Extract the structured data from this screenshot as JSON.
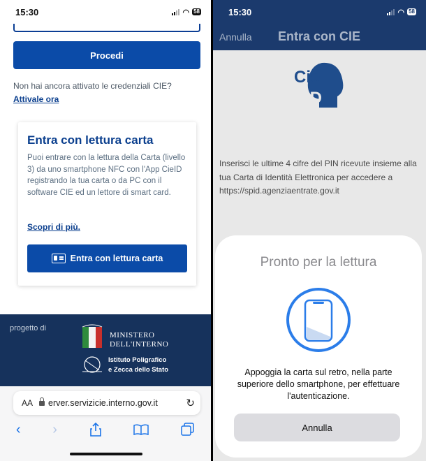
{
  "left": {
    "status": {
      "time": "15:30",
      "battery": "58"
    },
    "procedi_label": "Procedi",
    "not_activated_text": "Non hai ancora attivato le credenziali CIE?",
    "activate_link": "Attivale ora",
    "card": {
      "title": "Entra con lettura carta",
      "text": "Puoi entrare con la lettura della Carta (livello 3) da uno smartphone NFC con l'App CieID registrando la tua carta o da PC con il software CIE ed un lettore di smart card.",
      "more_link": "Scopri di più.",
      "button_label": "Entra con lettura carta"
    },
    "footer": {
      "project_of": "progetto di",
      "ministero_line1": "MINISTERO",
      "ministero_line2": "DELL'INTERNO",
      "ipzs_line1": "Istituto Poligrafico",
      "ipzs_line2": "e Zecca dello Stato"
    },
    "browser": {
      "aa_label": "AA",
      "url": "erver.servizicie.interno.gov.it"
    }
  },
  "right": {
    "status": {
      "time": "15:30",
      "battery": "58"
    },
    "nav_cancel": "Annulla",
    "nav_title": "Entra con CIE",
    "logo_text_top": "Cie",
    "logo_text_bottom": "ID",
    "instructions": "Inserisci le ultime 4 cifre del PIN ricevute insieme alla tua Carta di Identità Elettronica per accedere a https://spid.agenziaentrate.gov.it",
    "sheet": {
      "title": "Pronto per la lettura",
      "message": "Appoggia la carta sul retro, nella parte superiore dello smartphone, per effettuare l'autenticazione.",
      "cancel_label": "Annulla"
    }
  },
  "colors": {
    "primary_blue": "#0b4ba8",
    "nav_blue": "#1b3a6d",
    "footer_blue": "#16325c",
    "nfc_ring": "#2b7de9"
  }
}
